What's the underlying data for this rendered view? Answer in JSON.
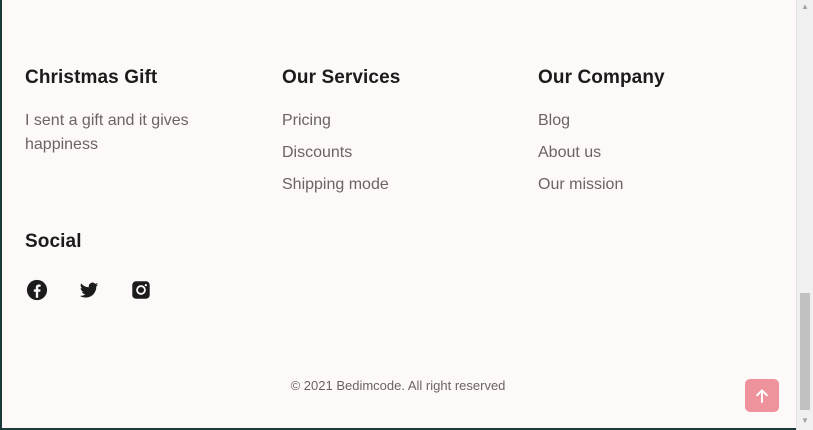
{
  "footer": {
    "gift": {
      "title": "Christmas Gift",
      "description": "I sent a gift and it gives happiness"
    },
    "services": {
      "title": "Our Services",
      "links": [
        "Pricing",
        "Discounts",
        "Shipping mode"
      ]
    },
    "company": {
      "title": "Our Company",
      "links": [
        "Blog",
        "About us",
        "Our mission"
      ]
    },
    "social": {
      "title": "Social",
      "icons": [
        "facebook-icon",
        "twitter-icon",
        "instagram-icon"
      ]
    },
    "copyright": "© 2021 Bedimcode. All right reserved"
  },
  "scroll_up": {
    "icon": "arrow-up-icon",
    "color": "#ee939b"
  },
  "colors": {
    "background": "#fdf9f8",
    "title": "#1c1b1b",
    "text": "#6a6464"
  }
}
